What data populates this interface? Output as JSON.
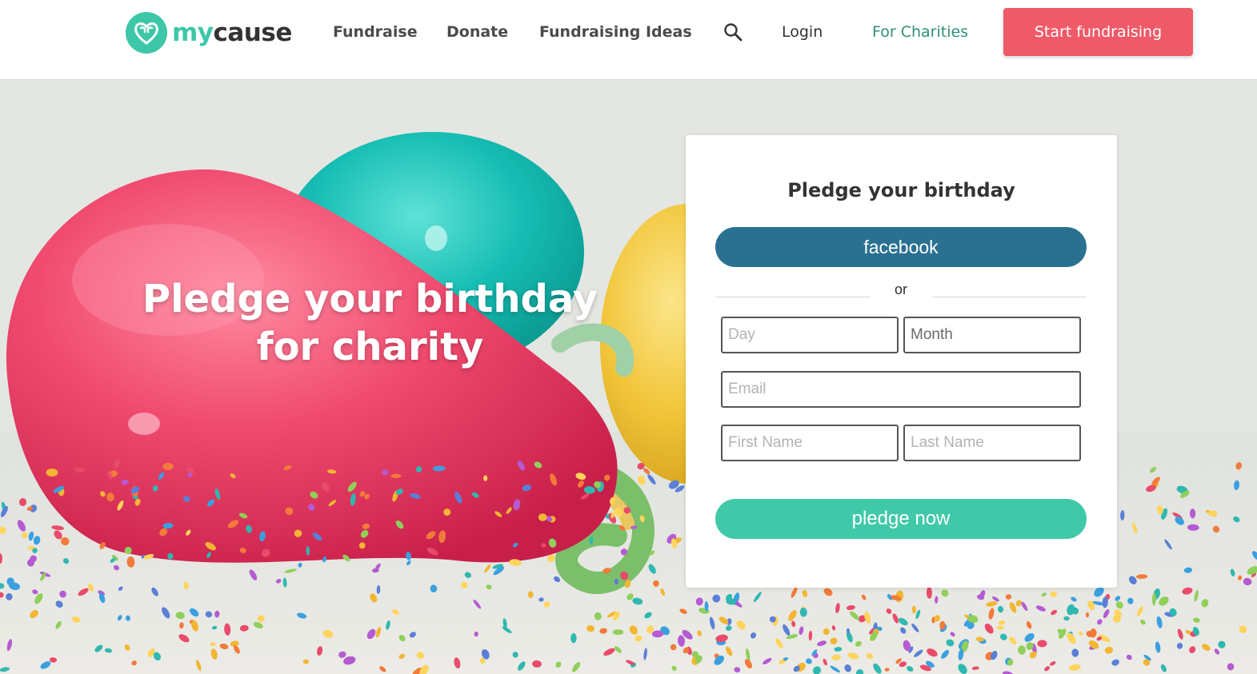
{
  "header": {
    "logo": {
      "my": "my",
      "cause": "cause"
    },
    "nav": {
      "fundraise": "Fundraise",
      "donate": "Donate",
      "ideas": "Fundraising Ideas",
      "login": "Login",
      "charities": "For Charities"
    },
    "search_icon": "search-icon",
    "start_button": "Start fundraising"
  },
  "hero": {
    "title_line1": "Pledge your birthday",
    "title_line2": "for charity"
  },
  "form": {
    "title": "Pledge your birthday",
    "facebook_button": "facebook",
    "or_text": "or",
    "day_placeholder": "Day",
    "month_placeholder": "Month",
    "email_placeholder": "Email",
    "first_name_placeholder": "First Name",
    "last_name_placeholder": "Last Name",
    "submit_button": "pledge now"
  },
  "colors": {
    "brand_teal": "#3dc7a8",
    "cta_coral": "#ef5a68",
    "facebook_blue": "#2a7191",
    "charities_green": "#2f8f7a"
  }
}
